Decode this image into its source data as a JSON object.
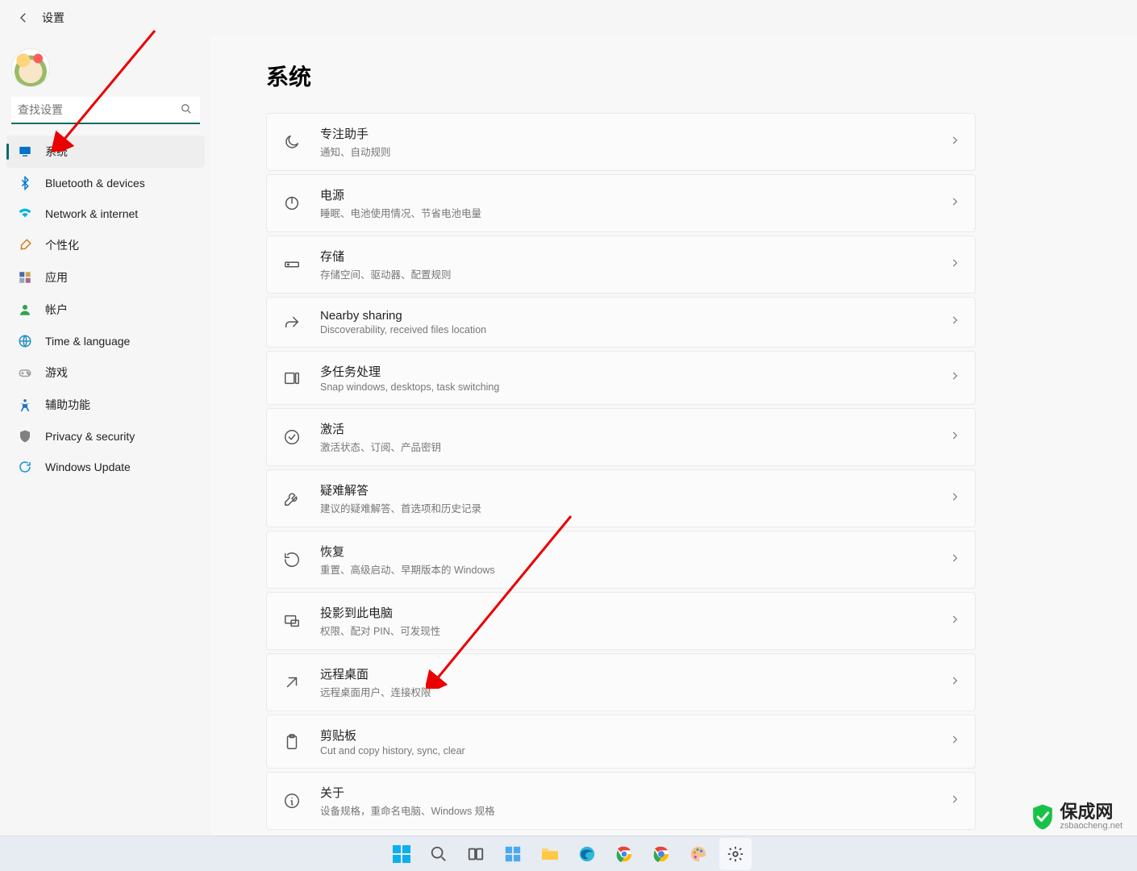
{
  "header": {
    "title": "设置"
  },
  "search": {
    "placeholder": "查找设置"
  },
  "sidebar": {
    "items": [
      {
        "label": "系统",
        "icon": "display",
        "color": "#0072ce",
        "active": true
      },
      {
        "label": "Bluetooth & devices",
        "icon": "bluetooth",
        "color": "#0078d4"
      },
      {
        "label": "Network & internet",
        "icon": "wifi",
        "color": "#00b7e0"
      },
      {
        "label": "个性化",
        "icon": "brush",
        "color": "#d47b17"
      },
      {
        "label": "应用",
        "icon": "apps",
        "color": "#4c68a6"
      },
      {
        "label": "帐户",
        "icon": "user",
        "color": "#2da34d"
      },
      {
        "label": "Time & language",
        "icon": "globe",
        "color": "#1e8fbf"
      },
      {
        "label": "游戏",
        "icon": "game",
        "color": "#9c9c9c"
      },
      {
        "label": "辅助功能",
        "icon": "accessibility",
        "color": "#1f73c7"
      },
      {
        "label": "Privacy & security",
        "icon": "shield",
        "color": "#808080"
      },
      {
        "label": "Windows Update",
        "icon": "update",
        "color": "#0d92d6"
      }
    ]
  },
  "page": {
    "title": "系统",
    "settings": [
      {
        "title": "专注助手",
        "sub": "通知、自动规则",
        "icon": "moon"
      },
      {
        "title": "电源",
        "sub": "睡眠、电池使用情况、节省电池电量",
        "icon": "power"
      },
      {
        "title": "存储",
        "sub": "存储空间、驱动器、配置规则",
        "icon": "storage"
      },
      {
        "title": "Nearby sharing",
        "sub": "Discoverability, received files location",
        "icon": "share"
      },
      {
        "title": "多任务处理",
        "sub": "Snap windows, desktops, task switching",
        "icon": "multitask"
      },
      {
        "title": "激活",
        "sub": "激活状态、订阅、产品密钥",
        "icon": "check"
      },
      {
        "title": "疑难解答",
        "sub": "建议的疑难解答、首选项和历史记录",
        "icon": "wrench"
      },
      {
        "title": "恢复",
        "sub": "重置、高级启动、早期版本的 Windows",
        "icon": "recovery"
      },
      {
        "title": "投影到此电脑",
        "sub": "权限、配对 PIN、可发现性",
        "icon": "project"
      },
      {
        "title": "远程桌面",
        "sub": "远程桌面用户、连接权限",
        "icon": "remote"
      },
      {
        "title": "剪贴板",
        "sub": "Cut and copy history, sync, clear",
        "icon": "clipboard"
      },
      {
        "title": "关于",
        "sub": "设备规格，重命名电脑、Windows 规格",
        "icon": "info"
      }
    ]
  },
  "watermark": {
    "brand": "保成网",
    "url": "zsbaocheng.net"
  }
}
